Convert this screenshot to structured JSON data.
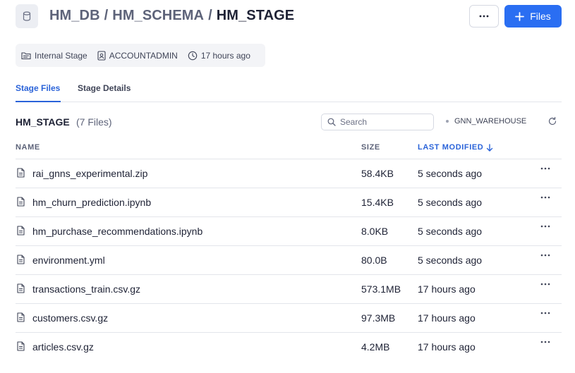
{
  "header": {
    "db_icon": "database-icon",
    "breadcrumb": {
      "database": "HM_DB",
      "schema": "HM_SCHEMA",
      "stage": "HM_STAGE",
      "separator": "/"
    },
    "more_icon": "more-horizontal-icon",
    "files_button": {
      "icon": "plus-icon",
      "label": "Files"
    }
  },
  "meta": {
    "type": {
      "icon": "folder-stage-icon",
      "label": "Internal Stage"
    },
    "owner": {
      "icon": "user-badge-icon",
      "label": "ACCOUNTADMIN"
    },
    "created": {
      "icon": "clock-icon",
      "label": "17 hours ago"
    }
  },
  "tabs": [
    {
      "label": "Stage Files",
      "active": true
    },
    {
      "label": "Stage Details",
      "active": false
    }
  ],
  "toolbar": {
    "title": "HM_STAGE",
    "count": "(7 Files)",
    "search_placeholder": "Search",
    "warehouse": "GNN_WAREHOUSE",
    "refresh_icon": "refresh-icon"
  },
  "table": {
    "columns": {
      "name": "NAME",
      "size": "SIZE",
      "modified": "LAST MODIFIED"
    },
    "sort": {
      "column": "modified",
      "direction": "descending"
    },
    "rows": [
      {
        "name": "rai_gnns_experimental.zip",
        "size": "58.4KB",
        "modified": "5 seconds ago"
      },
      {
        "name": "hm_churn_prediction.ipynb",
        "size": "15.4KB",
        "modified": "5 seconds ago"
      },
      {
        "name": "hm_purchase_recommendations.ipynb",
        "size": "8.0KB",
        "modified": "5 seconds ago"
      },
      {
        "name": "environment.yml",
        "size": "80.0B",
        "modified": "5 seconds ago"
      },
      {
        "name": "transactions_train.csv.gz",
        "size": "573.1MB",
        "modified": "17 hours ago"
      },
      {
        "name": "customers.csv.gz",
        "size": "97.3MB",
        "modified": "17 hours ago"
      },
      {
        "name": "articles.csv.gz",
        "size": "4.2MB",
        "modified": "17 hours ago"
      }
    ]
  },
  "colors": {
    "accent": "#2a6ef2",
    "active_tab": "#2a63d9",
    "text_primary": "#1e2235",
    "text_secondary": "#5d6379",
    "divider": "#e3e5eb"
  }
}
